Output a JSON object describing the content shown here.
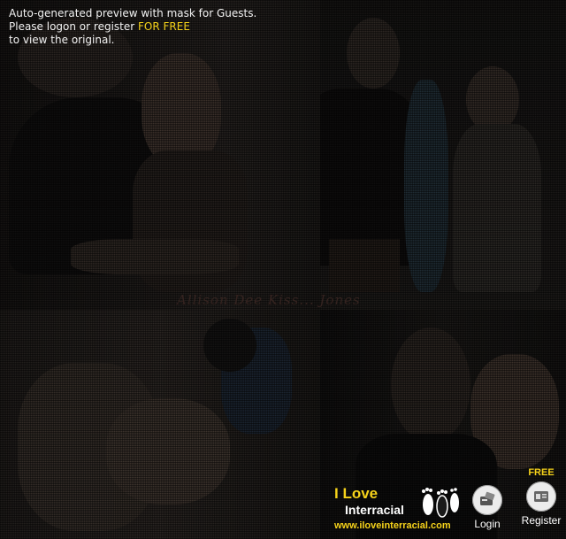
{
  "notice": {
    "line1": "Auto-generated preview with mask for Guests.",
    "line2_prefix": "Please logon or register ",
    "line2_highlight": "FOR FREE",
    "line3": "to view the original."
  },
  "watermark": "Allison Dee Kiss... Jones",
  "brand": {
    "line1": "I Love",
    "line2": "Interracial",
    "url": "www.iloveinterracial.com"
  },
  "actions": {
    "login_label": "Login",
    "register_label": "Register",
    "register_badge": "FREE"
  },
  "icons": {
    "login": "card-reader-icon",
    "register": "id-card-icon",
    "logo": "footprints-icon"
  },
  "colors": {
    "accent": "#f5d21a",
    "text": "#f2f2f2"
  }
}
